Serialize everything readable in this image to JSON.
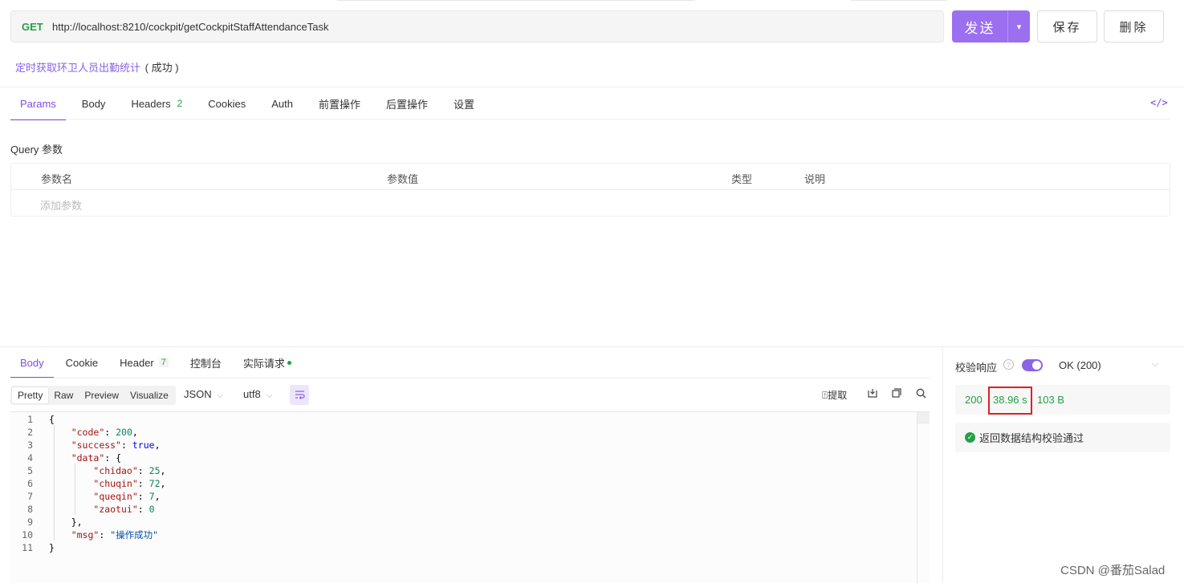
{
  "request": {
    "method": "GET",
    "url": "http://localhost:8210/cockpit/getCockpitStaffAttendanceTask",
    "send_label": "发送",
    "save_label": "保存",
    "delete_label": "删除",
    "api_name": "定时获取环卫人员出勤统计",
    "api_status": "( 成功 )"
  },
  "request_tabs": [
    {
      "label": "Params",
      "active": true
    },
    {
      "label": "Body"
    },
    {
      "label": "Headers",
      "count": "2"
    },
    {
      "label": "Cookies"
    },
    {
      "label": "Auth"
    },
    {
      "label": "前置操作"
    },
    {
      "label": "后置操作"
    },
    {
      "label": "设置"
    }
  ],
  "code_icon_label": "</>",
  "params": {
    "section_title": "Query 参数",
    "columns": [
      "参数名",
      "参数值",
      "类型",
      "说明"
    ],
    "add_placeholder": "添加参数"
  },
  "response_tabs": [
    {
      "label": "Body",
      "active": true
    },
    {
      "label": "Cookie"
    },
    {
      "label": "Header",
      "count": "7"
    },
    {
      "label": "控制台"
    },
    {
      "label": "实际请求"
    }
  ],
  "response_toolbar": {
    "formats": [
      "Pretty",
      "Raw",
      "Preview",
      "Visualize"
    ],
    "active_format": "Pretty",
    "language": "JSON",
    "encoding": "utf8",
    "extract_label": "提取"
  },
  "response_body": {
    "line_numbers": [
      "1",
      "2",
      "3",
      "4",
      "5",
      "6",
      "7",
      "8",
      "9",
      "10",
      "11"
    ]
  },
  "response_json": {
    "code": "200",
    "success": "true",
    "chidao": "25",
    "chuqin": "72",
    "queqin": "7",
    "zaotui": "0",
    "msg": "\"操作成功\""
  },
  "validation": {
    "label": "校验响应",
    "toggle_on": true,
    "status_text": "OK (200)",
    "status_code": "200",
    "time": "38.96 s",
    "size": "103 B",
    "result_text": "返回数据结构校验通过"
  },
  "colors": {
    "accent": "#8b63e6",
    "success": "#22a046",
    "highlight_border": "#e02020"
  },
  "watermark": "CSDN @番茄Salad"
}
